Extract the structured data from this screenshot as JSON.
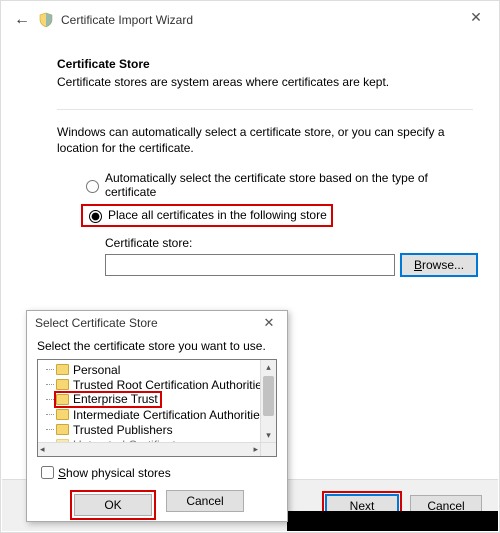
{
  "wizard": {
    "title": "Certificate Import Wizard",
    "heading": "Certificate Store",
    "subtext": "Certificate stores are system areas where certificates are kept.",
    "body": "Windows can automatically select a certificate store, or you can specify a location for the certificate.",
    "radio_auto": "Automatically select the certificate store based on the type of certificate",
    "radio_place": "Place all certificates in the following store",
    "store_label": "Certificate store:",
    "store_value": "",
    "browse": "Browse...",
    "next": "Next",
    "cancel": "Cancel"
  },
  "dialog": {
    "title": "Select Certificate Store",
    "instruction": "Select the certificate store you want to use.",
    "items": {
      "0": "Personal",
      "1": "Trusted Root Certification Authorities",
      "2": "Enterprise Trust",
      "3": "Intermediate Certification Authorities",
      "4": "Trusted Publishers",
      "5": "Untrusted Certificates"
    },
    "show_physical": "Show physical stores",
    "ok": "OK",
    "cancel": "Cancel"
  }
}
